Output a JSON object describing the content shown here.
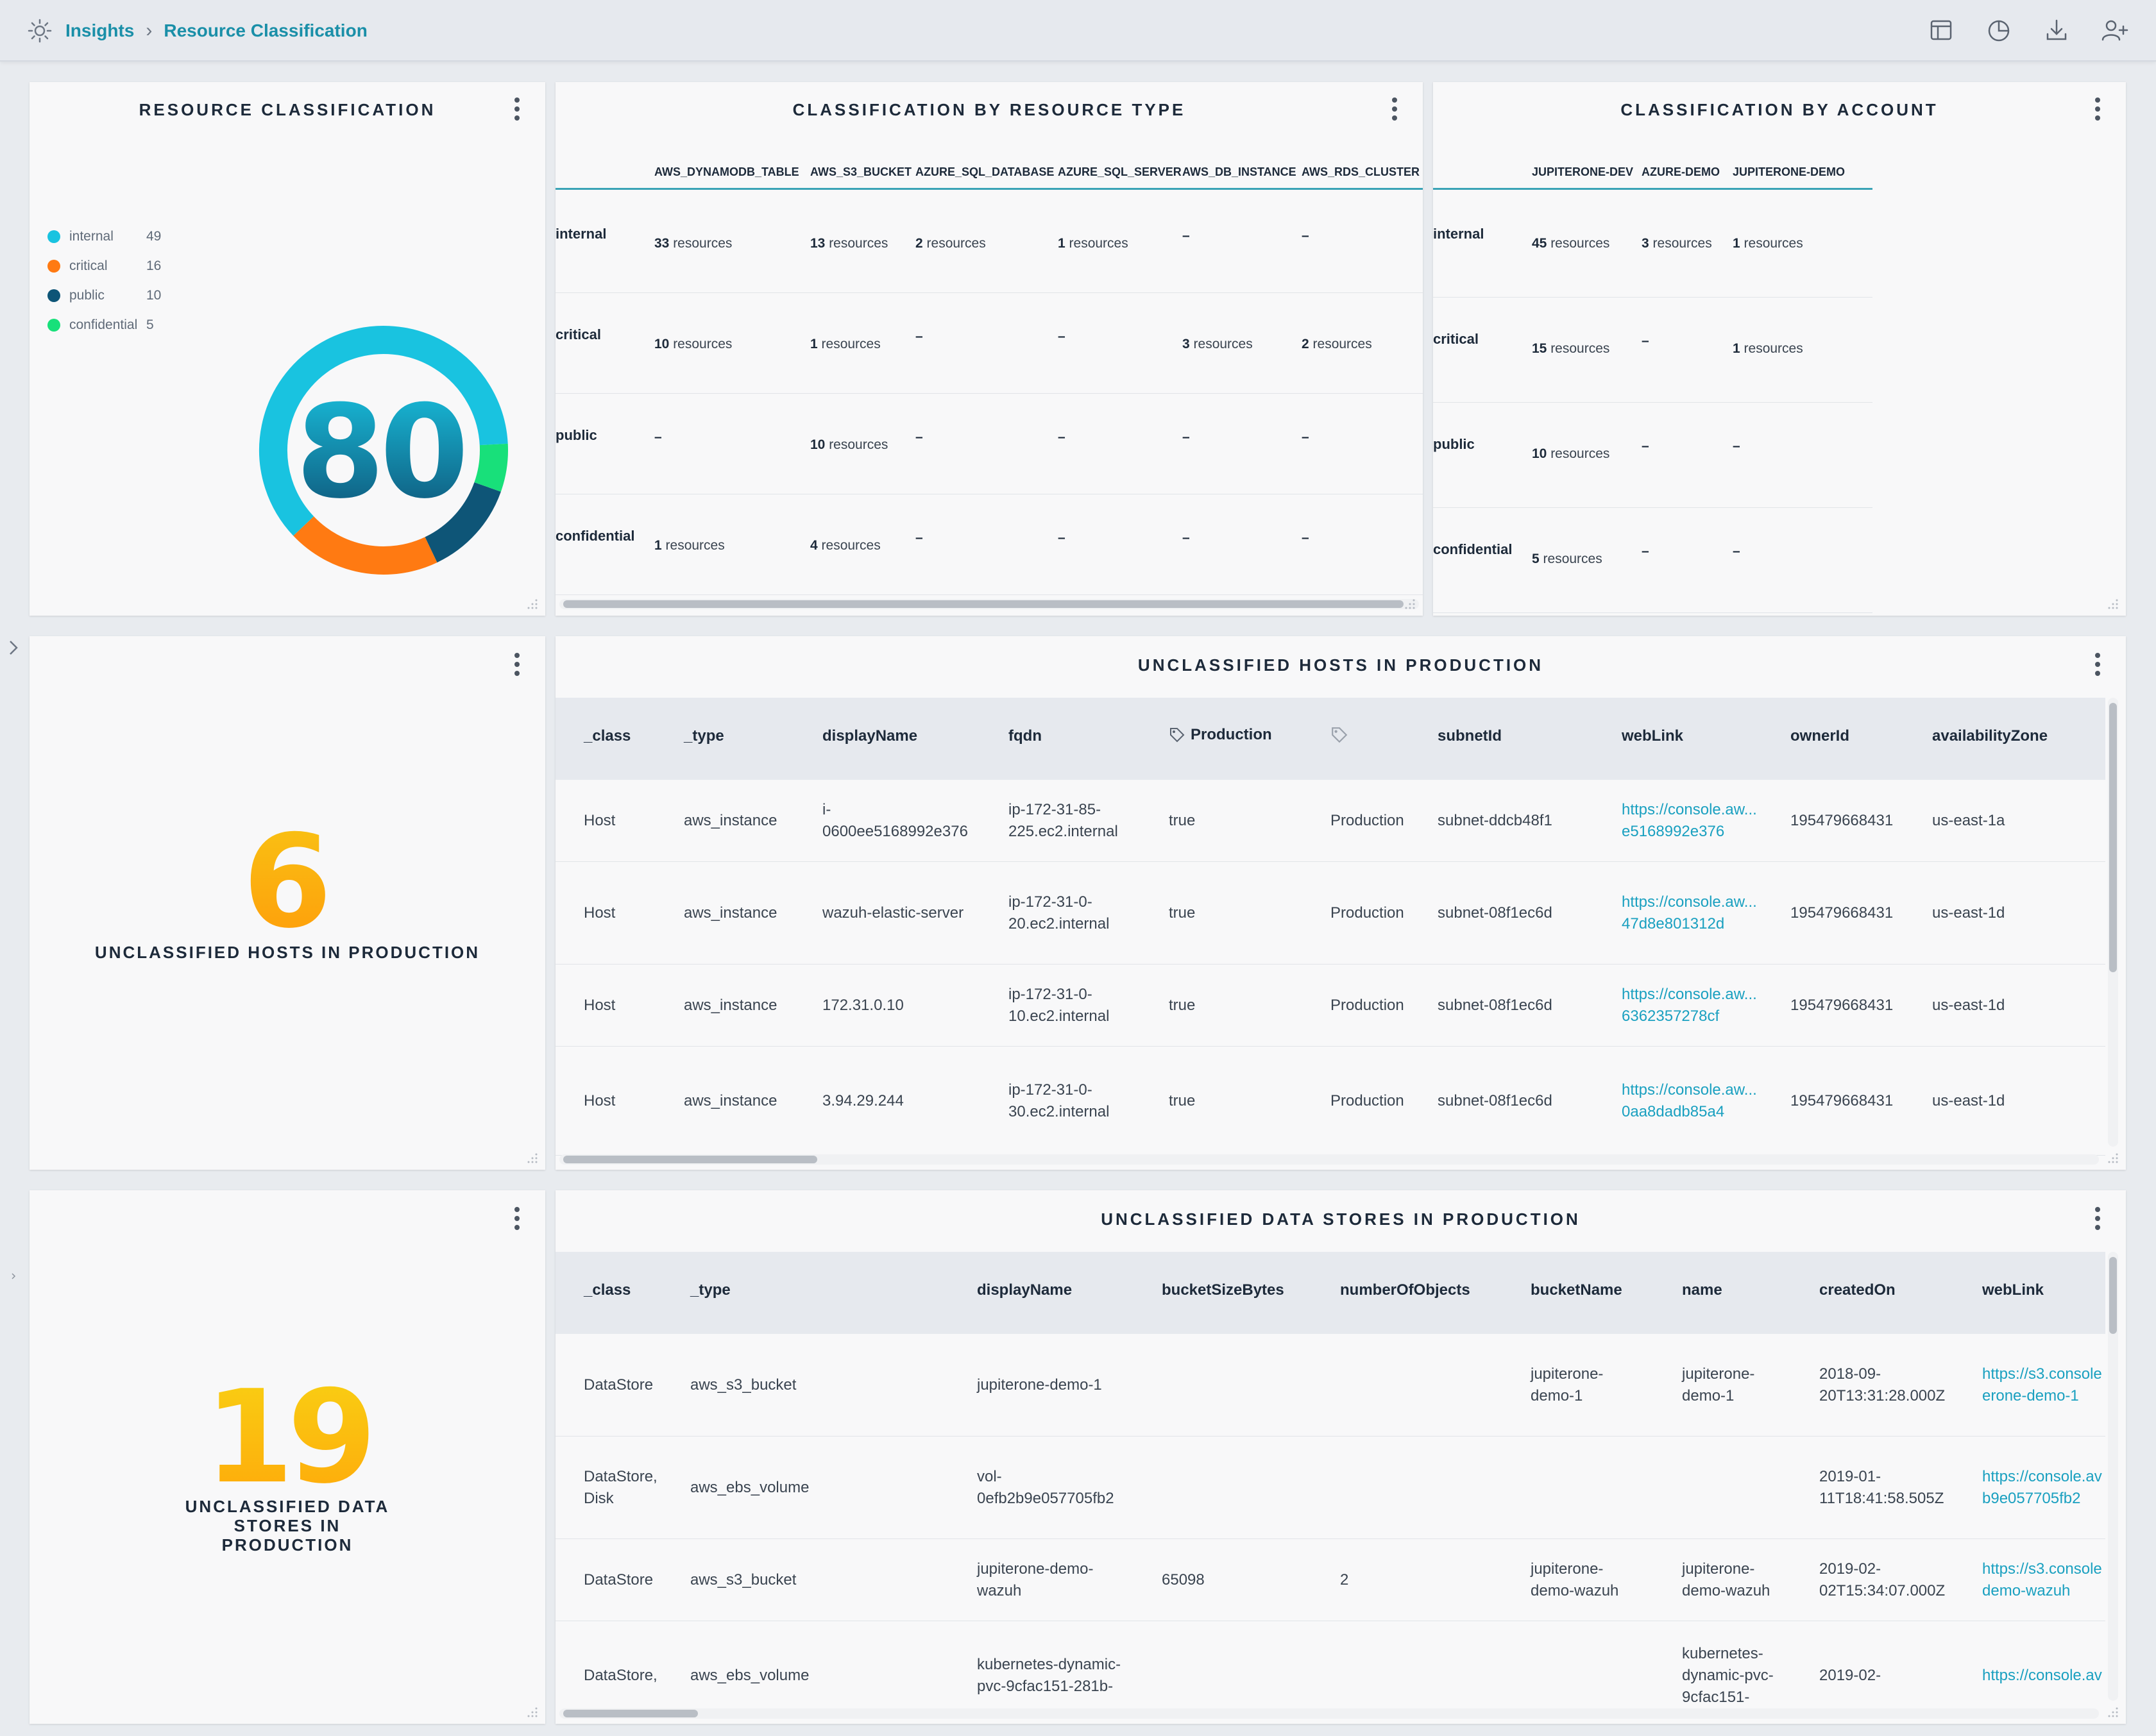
{
  "breadcrumb": {
    "root": "Insights",
    "current": "Resource Classification"
  },
  "top_actions": [
    "layout-icon",
    "pie-chart-icon",
    "download-icon",
    "add-user-icon"
  ],
  "colors": {
    "internal": "#19c3e0",
    "critical": "#ff7a12",
    "public": "#0e5577",
    "confidential": "#18e07a",
    "link": "#1aa0c0",
    "number_gold": "#f5b400"
  },
  "resource_classification": {
    "title": "RESOURCE CLASSIFICATION",
    "total": "80",
    "legend": [
      {
        "label": "internal",
        "value": "49"
      },
      {
        "label": "critical",
        "value": "16"
      },
      {
        "label": "public",
        "value": "10"
      },
      {
        "label": "confidential",
        "value": "5"
      }
    ]
  },
  "chart_data": {
    "type": "pie",
    "categories": [
      "internal",
      "critical",
      "public",
      "confidential"
    ],
    "values": [
      49,
      16,
      10,
      5
    ],
    "title": "RESOURCE CLASSIFICATION",
    "center_label": "80"
  },
  "by_type": {
    "title": "CLASSIFICATION BY RESOURCE TYPE",
    "columns": [
      "AWS_DYNAMODB_TABLE",
      "AWS_S3_BUCKET",
      "AZURE_SQL_DATABASE",
      "AZURE_SQL_SERVER",
      "AWS_DB_INSTANCE",
      "AWS_RDS_CLUSTER"
    ],
    "rows": [
      {
        "label": "internal",
        "cells": [
          [
            "33",
            " resources"
          ],
          [
            "13",
            " resources"
          ],
          [
            "2",
            " resources"
          ],
          [
            "1",
            " resources"
          ],
          [
            "–",
            ""
          ],
          [
            "–",
            ""
          ]
        ]
      },
      {
        "label": "critical",
        "cells": [
          [
            "10",
            " resources"
          ],
          [
            "1",
            " resources"
          ],
          [
            "–",
            ""
          ],
          [
            "–",
            ""
          ],
          [
            "3",
            " resources"
          ],
          [
            "2",
            " resources"
          ]
        ]
      },
      {
        "label": "public",
        "cells": [
          [
            "–",
            ""
          ],
          [
            "10",
            " resources"
          ],
          [
            "–",
            ""
          ],
          [
            "–",
            ""
          ],
          [
            "–",
            ""
          ],
          [
            "–",
            ""
          ]
        ]
      },
      {
        "label": "confidential",
        "cells": [
          [
            "1",
            " resources"
          ],
          [
            "4",
            " resources"
          ],
          [
            "–",
            ""
          ],
          [
            "–",
            ""
          ],
          [
            "–",
            ""
          ],
          [
            "–",
            ""
          ]
        ]
      }
    ]
  },
  "by_account": {
    "title": "CLASSIFICATION BY ACCOUNT",
    "columns": [
      "JUPITERONE-DEV",
      "AZURE-DEMO",
      "JUPITERONE-DEMO"
    ],
    "rows": [
      {
        "label": "internal",
        "cells": [
          [
            "45",
            " resources"
          ],
          [
            "3",
            " resources"
          ],
          [
            "1",
            " resources"
          ]
        ]
      },
      {
        "label": "critical",
        "cells": [
          [
            "15",
            " resources"
          ],
          [
            "–",
            ""
          ],
          [
            "1",
            " resources"
          ]
        ]
      },
      {
        "label": "public",
        "cells": [
          [
            "10",
            " resources"
          ],
          [
            "–",
            ""
          ],
          [
            "–",
            ""
          ]
        ]
      },
      {
        "label": "confidential",
        "cells": [
          [
            "5",
            " resources"
          ],
          [
            "–",
            ""
          ],
          [
            "–",
            ""
          ]
        ]
      }
    ]
  },
  "hosts_count": {
    "value": "6",
    "caption": "UNCLASSIFIED HOSTS IN PRODUCTION"
  },
  "hosts_table": {
    "title": "UNCLASSIFIED HOSTS IN PRODUCTION",
    "columns": [
      "_class",
      "_type",
      "displayName",
      "fqdn",
      "Production",
      "",
      "subnetId",
      "webLink",
      "ownerId",
      "availabilityZone"
    ],
    "rows": [
      [
        "Host",
        "aws_instance",
        "i-\n0600ee5168992e376",
        "ip-172-31-85-\n225.ec2.internal",
        "true",
        "Production",
        "subnet-ddcb48f1",
        "https://console.aw...\ne5168992e376",
        "195479668431",
        "us-east-1a"
      ],
      [
        "Host",
        "aws_instance",
        "wazuh-elastic-server",
        "ip-172-31-0-\n20.ec2.internal",
        "true",
        "Production",
        "subnet-08f1ec6d",
        "https://console.aw...\n47d8e801312d",
        "195479668431",
        "us-east-1d"
      ],
      [
        "Host",
        "aws_instance",
        "172.31.0.10",
        "ip-172-31-0-\n10.ec2.internal",
        "true",
        "Production",
        "subnet-08f1ec6d",
        "https://console.aw...\n6362357278cf",
        "195479668431",
        "us-east-1d"
      ],
      [
        "Host",
        "aws_instance",
        "3.94.29.244",
        "ip-172-31-0-\n30.ec2.internal",
        "true",
        "Production",
        "subnet-08f1ec6d",
        "https://console.aw...\n0aa8dadb85a4",
        "195479668431",
        "us-east-1d"
      ]
    ]
  },
  "stores_count": {
    "value": "19",
    "caption": "UNCLASSIFIED DATA STORES IN PRODUCTION"
  },
  "stores_table": {
    "title": "UNCLASSIFIED DATA STORES IN PRODUCTION",
    "columns": [
      "_class",
      "_type",
      "displayName",
      "bucketSizeBytes",
      "numberOfObjects",
      "bucketName",
      "name",
      "createdOn",
      "webLink"
    ],
    "rows": [
      [
        "DataStore",
        "aws_s3_bucket",
        "jupiterone-demo-1",
        "",
        "",
        "jupiterone-\ndemo-1",
        "jupiterone-\ndemo-1",
        "2018-09-\n20T13:31:28.000Z",
        "https://s3.console\nerone-demo-1"
      ],
      [
        "DataStore,\nDisk",
        "aws_ebs_volume",
        "vol-\n0efb2b9e057705fb2",
        "",
        "",
        "",
        "",
        "2019-01-\n11T18:41:58.505Z",
        "https://console.av\nb9e057705fb2"
      ],
      [
        "DataStore",
        "aws_s3_bucket",
        "jupiterone-demo-\nwazuh",
        "65098",
        "2",
        "jupiterone-\ndemo-wazuh",
        "jupiterone-\ndemo-wazuh",
        "2019-02-\n02T15:34:07.000Z",
        "https://s3.console\ndemo-wazuh"
      ],
      [
        "DataStore,",
        "aws_ebs_volume",
        "kubernetes-dynamic-\npvc-9cfac151-281b-",
        "",
        "",
        "",
        "kubernetes-\ndynamic-pvc-\n9cfac151-",
        "2019-02-",
        "https://console.av"
      ]
    ]
  }
}
